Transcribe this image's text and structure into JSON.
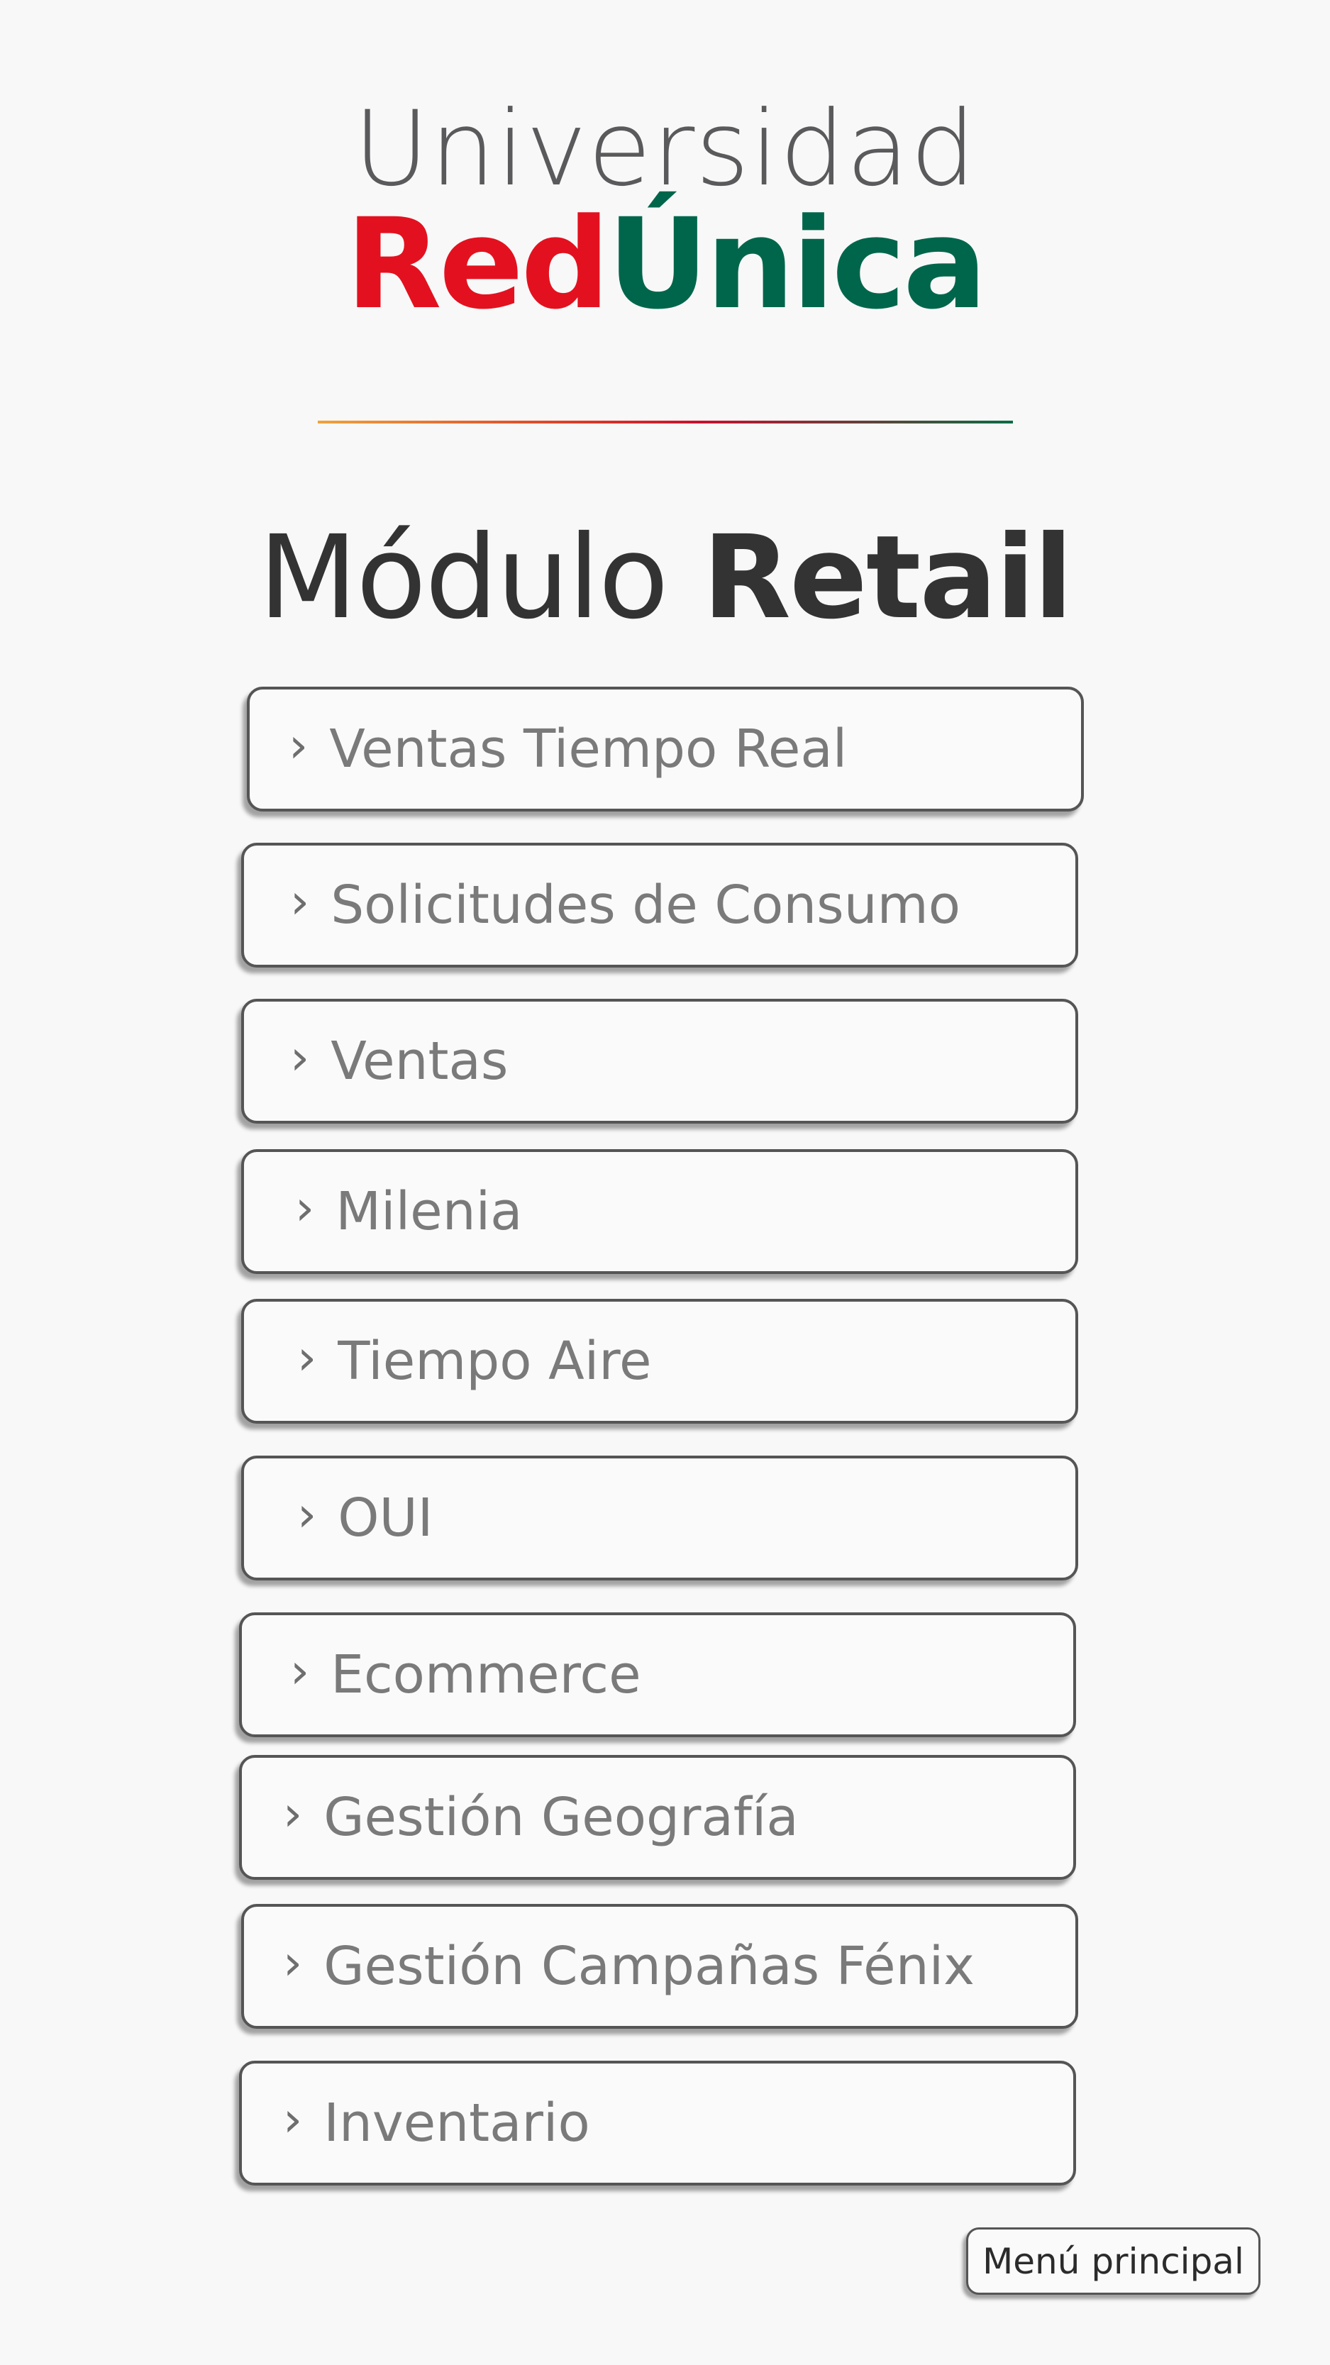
{
  "logo": {
    "line1": "Universidad",
    "line2_part1": "Red",
    "line2_part2": "Únic",
    "line2_part3": "a",
    "colors": {
      "gray": "#5a5a5c",
      "red": "#e3111f",
      "green": "#00664b"
    }
  },
  "header": {
    "title_light": "Módulo ",
    "title_bold": "Retail"
  },
  "menu": {
    "chevron": "›",
    "items": [
      {
        "label": "Ventas Tiempo Real"
      },
      {
        "label": "Solicitudes de Consumo"
      },
      {
        "label": "Ventas"
      },
      {
        "label": "Milenia"
      },
      {
        "label": "Tiempo Aire"
      },
      {
        "label": "OUI"
      },
      {
        "label": "Ecommerce"
      },
      {
        "label": "Gestión Geografía"
      },
      {
        "label": "Gestión Campañas Fénix"
      },
      {
        "label": "Inventario"
      }
    ]
  },
  "footer": {
    "main_menu_label": "Menú principal"
  }
}
